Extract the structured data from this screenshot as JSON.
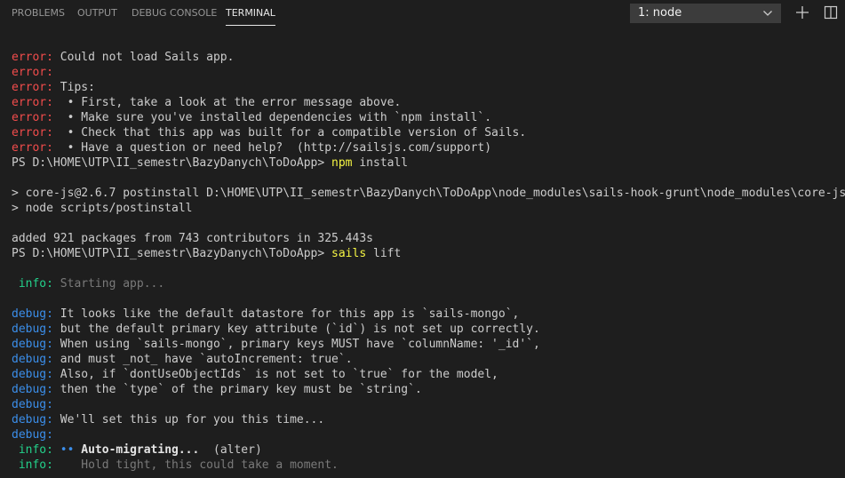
{
  "tabs": [
    {
      "label": "PROBLEMS",
      "active": false
    },
    {
      "label": "OUTPUT",
      "active": false
    },
    {
      "label": "DEBUG CONSOLE",
      "active": false
    },
    {
      "label": "TERMINAL",
      "active": true
    }
  ],
  "terminal_select": {
    "value": "1: node"
  },
  "toolbar": {
    "add_icon": "plus-icon",
    "split_icon": "split-icon"
  },
  "colors": {
    "background": "#1e1e1e",
    "error": "#f14c4c",
    "debug": "#3b8eea",
    "info": "#23d18b",
    "command": "#f5f543",
    "dim": "#7a7a7a",
    "text": "#cccccc"
  },
  "terminal": {
    "lines": [
      [
        {
          "t": "error:",
          "c": "error"
        },
        {
          "t": " Could not load Sails app."
        }
      ],
      [
        {
          "t": "error:",
          "c": "error"
        }
      ],
      [
        {
          "t": "error:",
          "c": "error"
        },
        {
          "t": " Tips:"
        }
      ],
      [
        {
          "t": "error:",
          "c": "error"
        },
        {
          "t": "  • First, take a look at the error message above."
        }
      ],
      [
        {
          "t": "error:",
          "c": "error"
        },
        {
          "t": "  • Make sure you've installed dependencies with `npm install`."
        }
      ],
      [
        {
          "t": "error:",
          "c": "error"
        },
        {
          "t": "  • Check that this app was built for a compatible version of Sails."
        }
      ],
      [
        {
          "t": "error:",
          "c": "error"
        },
        {
          "t": "  • Have a question or need help?  (http://sailsjs.com/support)"
        }
      ],
      [
        {
          "t": "PS D:\\HOME\\UTP\\II_semestr\\BazyDanych\\ToDoApp> "
        },
        {
          "t": "npm",
          "c": "cmd"
        },
        {
          "t": " install"
        }
      ],
      [],
      [
        {
          "t": "> core-js@2.6.7 postinstall D:\\HOME\\UTP\\II_semestr\\BazyDanych\\ToDoApp\\node_modules\\sails-hook-grunt\\node_modules\\core-js"
        }
      ],
      [
        {
          "t": "> node scripts/postinstall"
        }
      ],
      [],
      [
        {
          "t": "added 921 packages from 743 contributors in 325.443s"
        }
      ],
      [
        {
          "t": "PS D:\\HOME\\UTP\\II_semestr\\BazyDanych\\ToDoApp> "
        },
        {
          "t": "sails",
          "c": "cmd"
        },
        {
          "t": " lift"
        }
      ],
      [],
      [
        {
          "t": " info:",
          "c": "info"
        },
        {
          "t": " Starting app...",
          "c": "dim"
        }
      ],
      [],
      [
        {
          "t": "debug:",
          "c": "debug"
        },
        {
          "t": " It looks like the default datastore for this app is `sails-mongo`,"
        }
      ],
      [
        {
          "t": "debug:",
          "c": "debug"
        },
        {
          "t": " but the default primary key attribute (`id`) is not set up correctly."
        }
      ],
      [
        {
          "t": "debug:",
          "c": "debug"
        },
        {
          "t": " When using `sails-mongo`, primary keys MUST have `columnName: '_id'`,"
        }
      ],
      [
        {
          "t": "debug:",
          "c": "debug"
        },
        {
          "t": " and must _not_ have `autoIncrement: true`."
        }
      ],
      [
        {
          "t": "debug:",
          "c": "debug"
        },
        {
          "t": " Also, if `dontUseObjectIds` is not set to `true` for the model,"
        }
      ],
      [
        {
          "t": "debug:",
          "c": "debug"
        },
        {
          "t": " then the `type` of the primary key must be `string`."
        }
      ],
      [
        {
          "t": "debug:",
          "c": "debug"
        }
      ],
      [
        {
          "t": "debug:",
          "c": "debug"
        },
        {
          "t": " We'll set this up for you this time..."
        }
      ],
      [
        {
          "t": "debug:",
          "c": "debug"
        }
      ],
      [
        {
          "t": " info:",
          "c": "info"
        },
        {
          "t": " •• ",
          "c": "dot"
        },
        {
          "t": "Auto-migrating...",
          "c": "bold"
        },
        {
          "t": "  (alter)"
        }
      ],
      [
        {
          "t": " info:",
          "c": "info"
        },
        {
          "t": "    Hold tight, this could take a moment.",
          "c": "dim"
        }
      ]
    ]
  }
}
